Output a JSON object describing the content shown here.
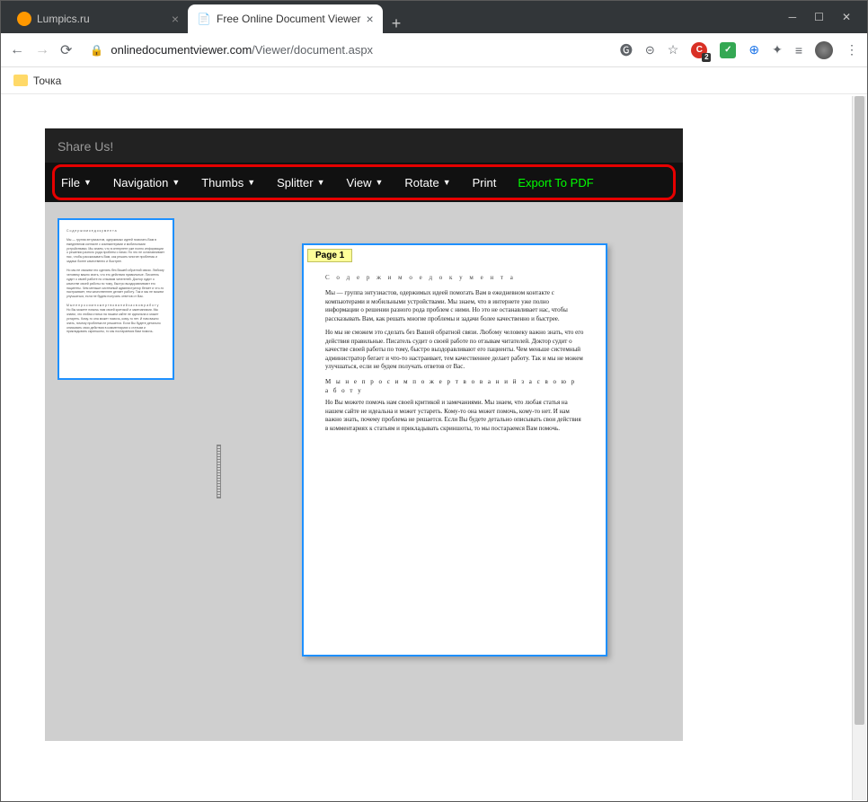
{
  "browser": {
    "tabs": [
      {
        "title": "Lumpics.ru",
        "favicon_color": "#ff9800",
        "active": false
      },
      {
        "title": "Free Online Document Viewer",
        "favicon_char": "📄",
        "active": true
      }
    ],
    "url_lock": true,
    "url_domain": "onlinedocumentviewer.com",
    "url_path": "/Viewer/document.aspx",
    "bookmark": "Точка"
  },
  "app": {
    "share_label": "Share Us!",
    "menu": {
      "file": "File",
      "navigation": "Navigation",
      "thumbs": "Thumbs",
      "splitter": "Splitter",
      "view": "View",
      "rotate": "Rotate",
      "print": "Print",
      "export": "Export To PDF"
    },
    "page_label": "Page 1",
    "document": {
      "heading1": "С о д е р ж и м о е   д о к у м е н т а",
      "para1": "Мы — группа энтузиастов, одержимых идеей помогать Вам в ежедневном контакте с компьютерами и мобильными устройствами. Мы знаем, что в интернете уже полно информации о решении разного рода проблем с ними. Но это не останавливает нас, чтобы рассказывать Вам, как решать многие проблемы и задачи более качественно и быстрее.",
      "para2": "Но мы не сможем это сделать без Вашей обратной связи. Любому человеку важно знать, что его действия правильные. Писатель судит о своей работе по отзывам читателей. Доктор судит о качестве своей работы по тому, быстро выздоравливают его пациенты. Чем меньше системный администратор бегает и что-то настраивает, тем качественнее делает работу. Так и мы не можем улучшаться, если не будем получать ответов от Вас.",
      "heading2": "М ы   н е   п р о с и м   п о ж е р т в о в а н и й   з а   с в о ю   р а б о т у",
      "para3": "Но Вы можете помочь нам своей критикой и замечаниями. Мы знаем, что любая статья на нашем сайте не идеальна и может устареть. Кому-то она может помочь, кому-то нет. И нам важно знать, почему проблема не решается. Если Вы будете детально описывать свои действия в комментариях к статьям и прикладывать скриншоты, то мы постараемся Вам помочь."
    }
  }
}
